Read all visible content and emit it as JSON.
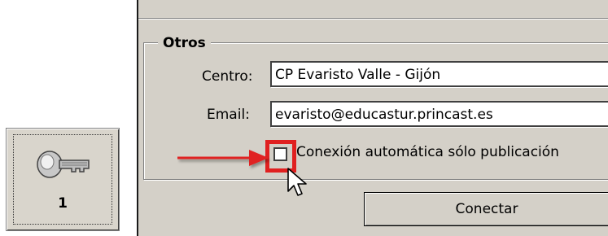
{
  "left_button": {
    "label": "1",
    "icon": "key-icon"
  },
  "group": {
    "title": "Otros"
  },
  "fields": {
    "centro": {
      "label": "Centro:",
      "value": "CP Evaristo Valle - Gijón"
    },
    "email": {
      "label": "Email:",
      "value": "evaristo@educastur.princast.es"
    }
  },
  "auto_connect": {
    "label": "Conexión automática sólo publicación",
    "checked": false
  },
  "connect_button": {
    "label": "Conectar"
  },
  "annotation": {
    "color": "#e02020"
  }
}
